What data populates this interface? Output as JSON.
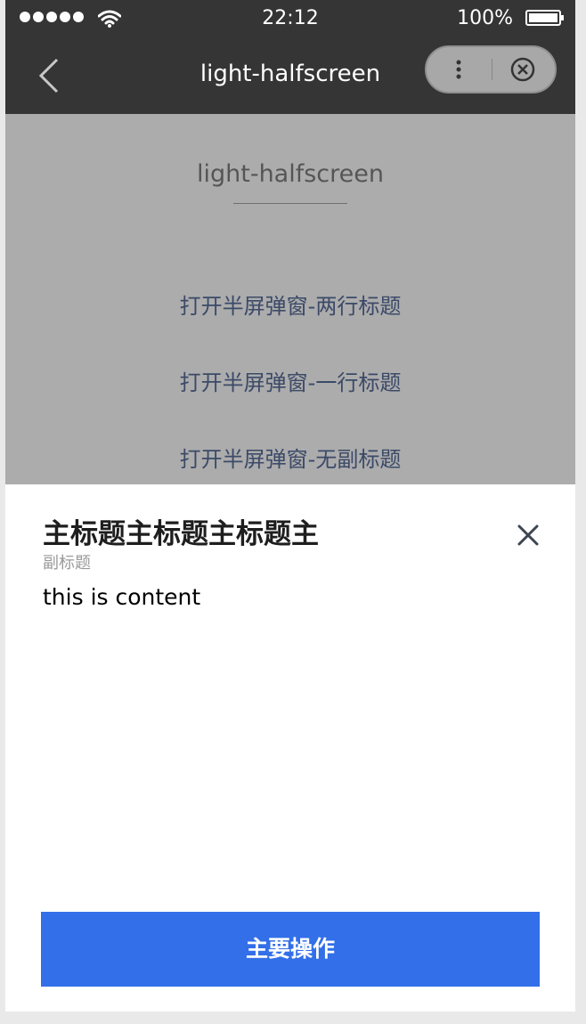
{
  "status_bar": {
    "time": "22:12",
    "battery": "100%"
  },
  "nav": {
    "title": "light-halfscreen"
  },
  "page": {
    "title": "light-halfscreen",
    "buttons": [
      {
        "label": "打开半屏弹窗-两行标题"
      },
      {
        "label": "打开半屏弹窗-一行标题"
      },
      {
        "label": "打开半屏弹窗-无副标题"
      }
    ]
  },
  "dialog": {
    "title": "主标题主标题主标题主",
    "subtitle": "副标题",
    "content": "this is content",
    "primary_button": "主要操作"
  },
  "colors": {
    "nav_background": "#353535",
    "primary": "#326fe8",
    "link": "#576b95"
  },
  "icons": {
    "back": "chevron-left-icon",
    "more": "more-vertical-icon",
    "close_capsule": "circle-close-icon",
    "dialog_close": "close-icon"
  }
}
